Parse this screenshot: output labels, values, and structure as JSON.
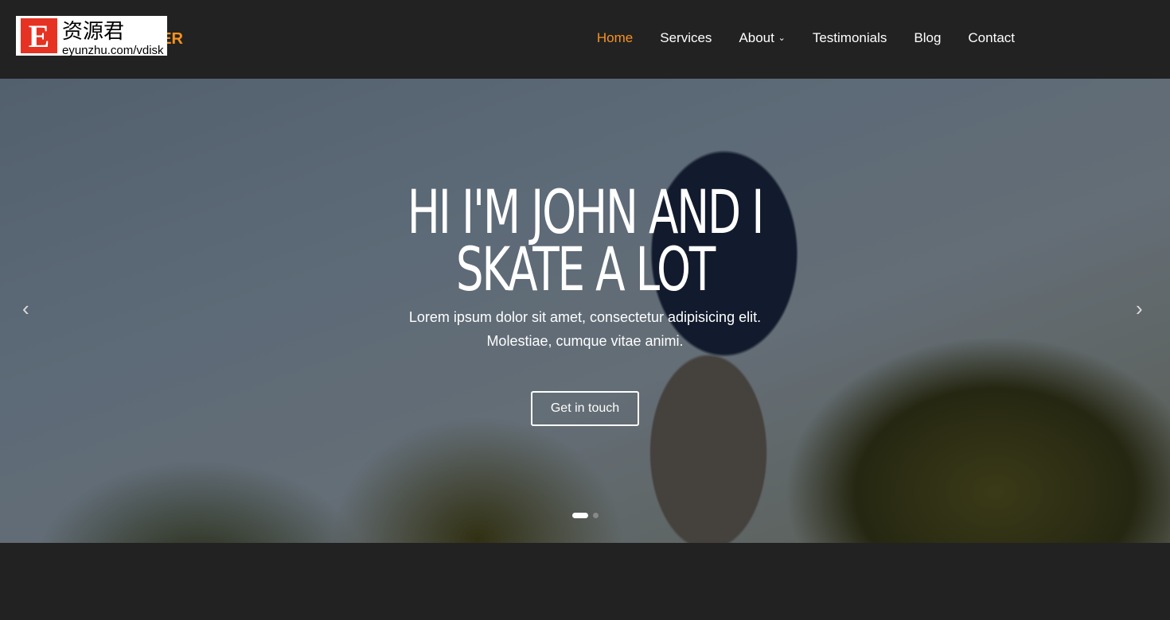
{
  "logo": {
    "text": "TER",
    "color": "#f7931e"
  },
  "watermark": {
    "letter": "E",
    "chinese": "资源君",
    "url": "eyunzhu.com/vdisk"
  },
  "nav": {
    "items": [
      {
        "label": "Home",
        "active": true
      },
      {
        "label": "Services"
      },
      {
        "label": "About",
        "dropdown": true,
        "icon": "chevron-down-icon"
      },
      {
        "label": "Testimonials"
      },
      {
        "label": "Blog"
      },
      {
        "label": "Contact"
      }
    ],
    "accent": "#f7931e"
  },
  "hero": {
    "title_line1": "HI I'M JOHN AND I",
    "title_line2": "SKATE A LOT",
    "subtitle_line1": "Lorem ipsum dolor sit amet, consectetur adipisicing elit.",
    "subtitle_line2": "Molestiae, cumque vitae animi.",
    "button": "Get in touch",
    "prev_icon": "chevron-left-icon",
    "next_icon": "chevron-right-icon",
    "prev": "‹",
    "next": "›",
    "slides": 2,
    "active_slide": 1
  }
}
